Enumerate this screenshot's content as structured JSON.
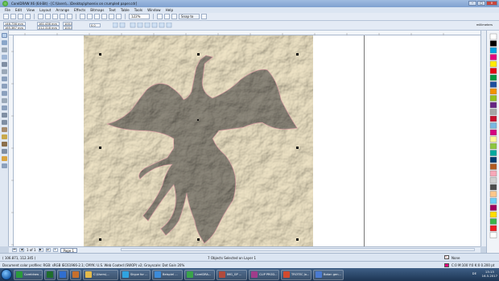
{
  "window": {
    "title": "CorelDRAW X6 (64-Bit) - [C:\\Users\\...\\Desktop\\phoenix on crumpled paper.cdr]",
    "controls": {
      "minimize": "–",
      "maximize": "□",
      "close": "×"
    }
  },
  "menu": [
    "File",
    "Edit",
    "View",
    "Layout",
    "Arrange",
    "Effects",
    "Bitmaps",
    "Text",
    "Table",
    "Tools",
    "Window",
    "Help"
  ],
  "toolbar": {
    "zoom_value": "122%",
    "snap_label": "Snap to"
  },
  "propbar": {
    "x": "146.736 mm",
    "y": "165.367 mm",
    "w": "161.436 mm",
    "h": "212.318 mm",
    "scale_w": "100.0",
    "scale_h": "100.0",
    "angle": "0.0",
    "units_label": "millimeters"
  },
  "pages": {
    "counter": "1 of 1",
    "tab_label": "Page 1"
  },
  "status": {
    "coords": "( 106.871, 112.345 )",
    "selection_text": "7 Objects Selected on Layer 1",
    "fill_label": "None",
    "outline_label": "C:0 M:100 Y:0 K:0 0.200 pt",
    "color_profiles": "Document color profiles: RGB: sRGB IEC61966-2.1; CMYK: U.S. Web Coated (SWOP) v2; Grayscale: Dot Gain 20%"
  },
  "taskbar": {
    "items": [
      {
        "label": "Coreldraw ...",
        "color": "#2a9a3c"
      },
      {
        "label": "",
        "color": "#1f6d2c"
      },
      {
        "label": "",
        "color": "#2f6ecf"
      },
      {
        "label": "",
        "color": "#c76f2c"
      },
      {
        "label": "C:\\Users\\...",
        "color": "#e3b94a"
      },
      {
        "label": "Skype for ...",
        "color": "#2fa3e0"
      },
      {
        "label": "Beispiel ...",
        "color": "#3c8bd9"
      },
      {
        "label": "CorelDRA...",
        "color": "#3aa34a"
      },
      {
        "label": "IMG_GP ...",
        "color": "#b04b3d"
      },
      {
        "label": "CLIP PROD...",
        "color": "#a03c8a"
      },
      {
        "label": "TROTEC Jo...",
        "color": "#d24a2e"
      },
      {
        "label": "Botan gen...",
        "color": "#4a7ad0"
      }
    ],
    "language": "DE",
    "time": "13:13",
    "date": "16.5.2017"
  },
  "palette_colors": [
    "#ffffff",
    "#000000",
    "#00a0e0",
    "#e4007c",
    "#ffed00",
    "#e30613",
    "#009640",
    "#1d4e9e",
    "#f39200",
    "#95c11f",
    "#662483",
    "#a6a6a6",
    "#c8102e",
    "#7ab8e0",
    "#d5007f",
    "#fff799",
    "#8ec63f",
    "#00a99d",
    "#003b6f",
    "#b15b20",
    "#f7a8b8",
    "#cfcfcf",
    "#4d4d4d",
    "#fdc689",
    "#6dcff6",
    "#9e005d",
    "#ffde00",
    "#39b54a",
    "#ed1c24",
    "#ffffff"
  ]
}
